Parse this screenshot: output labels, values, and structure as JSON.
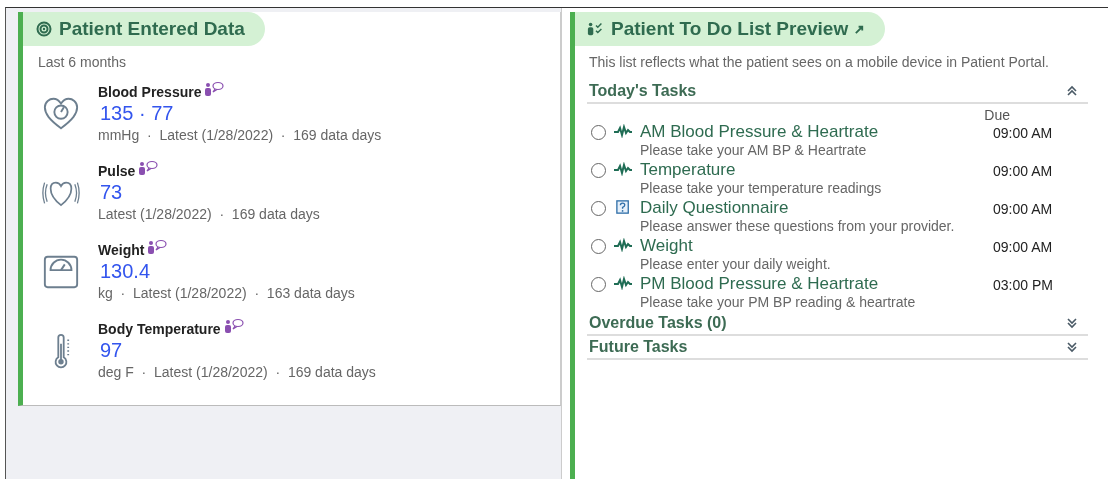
{
  "entered_data": {
    "title": "Patient Entered Data",
    "period": "Last 6 months",
    "measurements": [
      {
        "kind": "blood-pressure",
        "name": "Blood Pressure",
        "value": "135 · 77",
        "meta": "mmHg  ·  Latest (1/28/2022)  ·  169 data days"
      },
      {
        "kind": "pulse",
        "name": "Pulse",
        "value": "73",
        "meta": "Latest (1/28/2022)  ·  169 data days"
      },
      {
        "kind": "weight",
        "name": "Weight",
        "value": "130.4",
        "meta": "kg  ·  Latest (1/28/2022)  ·  163 data days"
      },
      {
        "kind": "temperature",
        "name": "Body Temperature",
        "value": "97",
        "meta": "deg F  ·  Latest (1/28/2022)  ·  169 data days"
      }
    ]
  },
  "todo_preview": {
    "title": "Patient To Do List Preview",
    "description": "This list reflects what the patient sees on a mobile device in Patient Portal.",
    "sections": [
      {
        "title": "Today's Tasks",
        "expanded": true,
        "due_header": "Due",
        "tasks": [
          {
            "kind": "vital",
            "title": "AM Blood Pressure & Heartrate",
            "description": "Please take your AM BP & Heartrate",
            "due": "09:00 AM",
            "checked": false
          },
          {
            "kind": "vital",
            "title": "Temperature",
            "description": "Please take your temperature readings",
            "due": "09:00 AM",
            "checked": false
          },
          {
            "kind": "questionnaire",
            "title": "Daily Questionnaire",
            "description": "Please answer these questions from your provider.",
            "due": "09:00 AM",
            "checked": false
          },
          {
            "kind": "vital",
            "title": "Weight",
            "description": "Please enter your daily weight.",
            "due": "09:00 AM",
            "checked": false
          },
          {
            "kind": "vital",
            "title": "PM Blood Pressure & Heartrate",
            "description": "Please take your PM BP reading & heartrate",
            "due": "03:00 PM",
            "checked": false
          }
        ]
      },
      {
        "title": "Overdue Tasks (0)",
        "expanded": false
      },
      {
        "title": "Future Tasks",
        "expanded": false
      }
    ]
  }
}
